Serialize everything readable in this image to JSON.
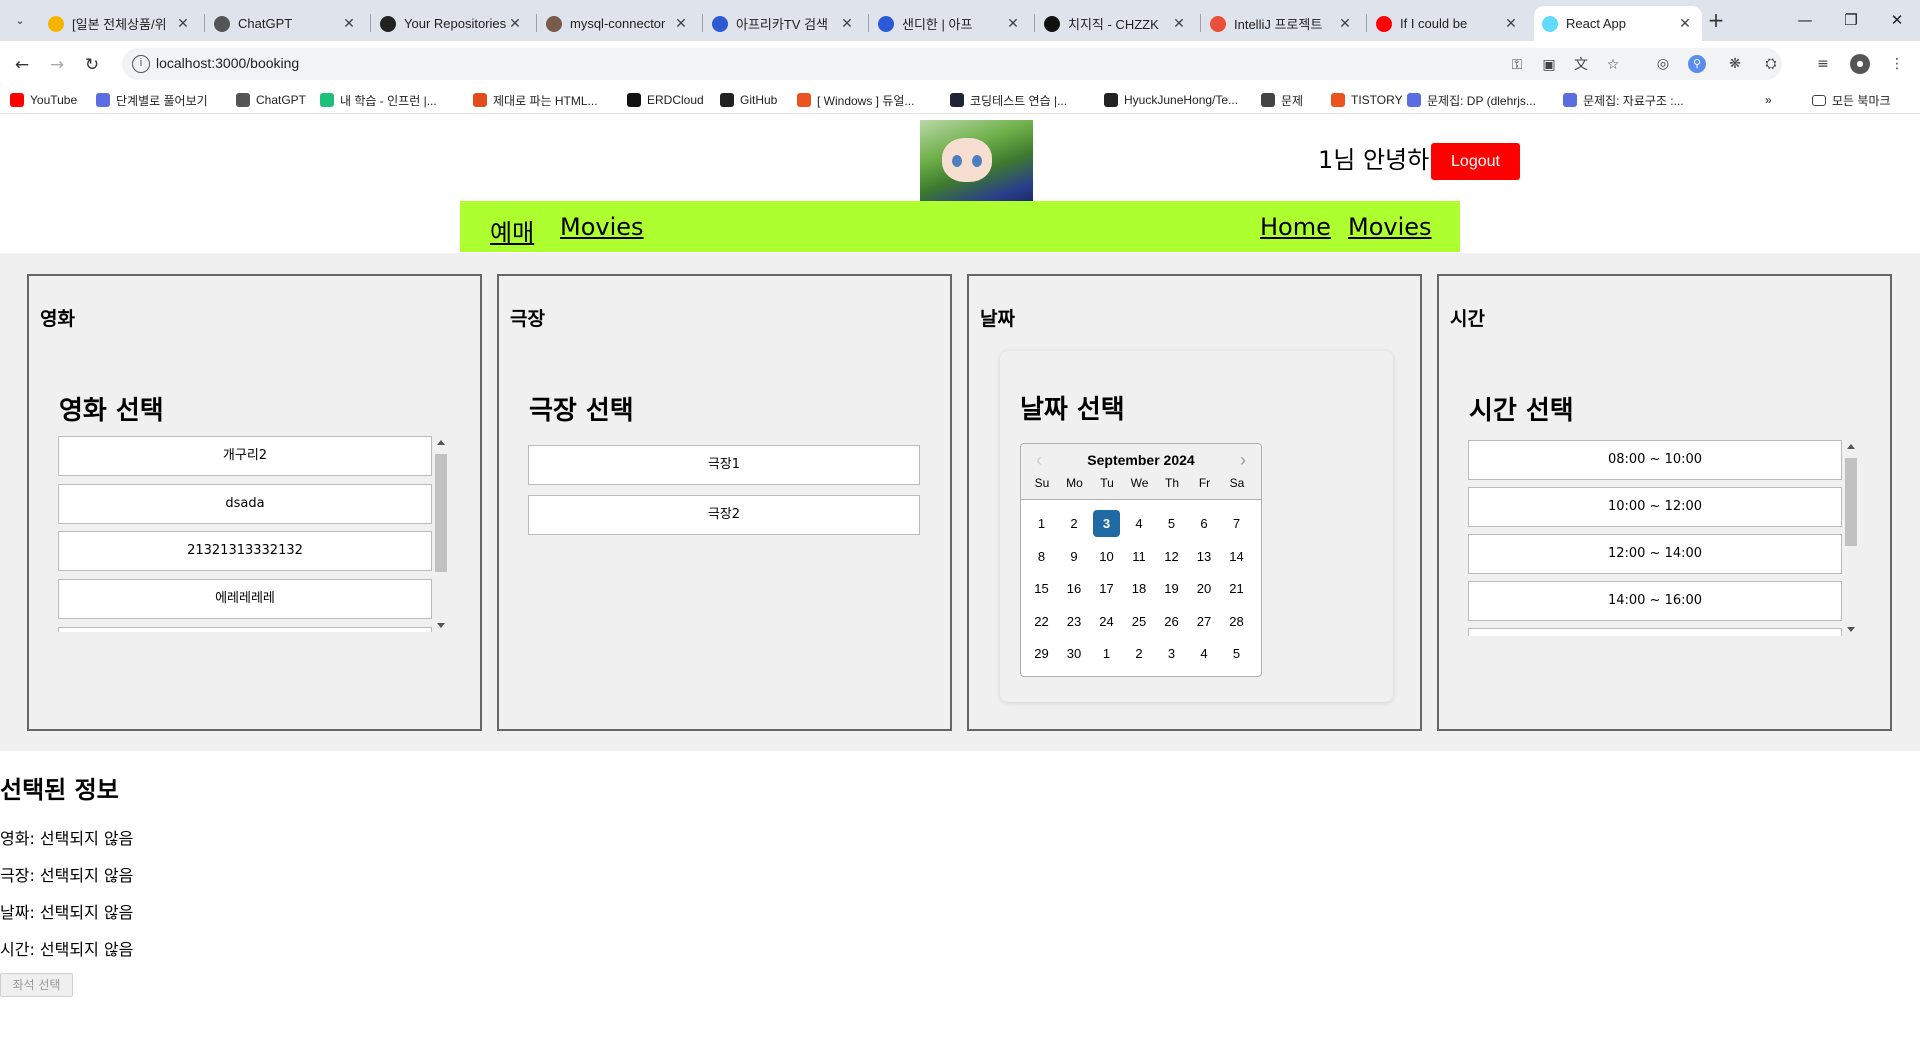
{
  "browser": {
    "tabs": [
      {
        "title": "[일본 전체상품/위",
        "icon": "store-icon",
        "color": "#f4b400"
      },
      {
        "title": "ChatGPT",
        "icon": "chatgpt-icon",
        "color": "#555555"
      },
      {
        "title": "Your Repositories",
        "icon": "github-icon",
        "color": "#222222"
      },
      {
        "title": "mysql-connector",
        "icon": "avatar-icon",
        "color": "#7a5a4a"
      },
      {
        "title": "아프리카TV 검색",
        "icon": "afreeca-icon",
        "color": "#2c5ad6"
      },
      {
        "title": "샌디한 | 아프",
        "icon": "afreeca-icon",
        "color": "#2c5ad6"
      },
      {
        "title": "치지직 - CHZZK",
        "icon": "chzzk-icon",
        "color": "#111111"
      },
      {
        "title": "IntelliJ 프로젝트",
        "icon": "inflearn-icon",
        "color": "#e8503a"
      },
      {
        "title": "If I could be",
        "icon": "youtube-icon",
        "color": "#ff0000"
      },
      {
        "title": "React App",
        "icon": "react-icon",
        "color": "#61dafb"
      }
    ],
    "url": "localhost:3000/booking",
    "bookmarks": [
      {
        "label": "YouTube",
        "icon": "youtube-icon",
        "color": "#ff0000"
      },
      {
        "label": "단계별로 풀어보기",
        "icon": "code-icon",
        "color": "#5b6ee1"
      },
      {
        "label": "ChatGPT",
        "icon": "chatgpt-icon",
        "color": "#555555"
      },
      {
        "label": "내 학습 - 인프런 |...",
        "icon": "inflearn-icon",
        "color": "#1dc078"
      },
      {
        "label": "제대로 파는 HTML...",
        "icon": "yalco-icon",
        "color": "#e24b1e"
      },
      {
        "label": "ERDCloud",
        "icon": "erd-icon",
        "color": "#111111"
      },
      {
        "label": "GitHub",
        "icon": "github-icon",
        "color": "#222222"
      },
      {
        "label": "[ Windows ] 듀얼...",
        "icon": "tistory-icon",
        "color": "#eb531f"
      },
      {
        "label": "코딩테스트 연습 |...",
        "icon": "programmers-icon",
        "color": "#1e2434"
      },
      {
        "label": "HyuckJuneHong/Te...",
        "icon": "github-icon",
        "color": "#222222"
      },
      {
        "label": "문제",
        "icon": "folder-icon",
        "color": "#444444"
      },
      {
        "label": "TISTORY",
        "icon": "tistory-icon",
        "color": "#eb531f"
      },
      {
        "label": "문제집: DP (dlehrjs...",
        "icon": "code-icon",
        "color": "#5b6ee1"
      },
      {
        "label": "문제집: 자료구조 :...",
        "icon": "code-icon",
        "color": "#5b6ee1"
      }
    ],
    "all_bookmarks": "모든 북마크"
  },
  "header": {
    "greeting": "1님 안녕하",
    "logout": "Logout"
  },
  "nav": {
    "left": [
      "예매",
      "Movies"
    ],
    "right": [
      "Home",
      "Movies"
    ]
  },
  "panels": {
    "movie": {
      "title": "영화",
      "heading": "영화 선택",
      "items": [
        "개구리2",
        "dsada",
        "21321313332132",
        "에레레레레"
      ]
    },
    "theater": {
      "title": "극장",
      "heading": "극장 선택",
      "items": [
        "극장1",
        "극장2"
      ]
    },
    "date": {
      "title": "날짜",
      "heading": "날짜 선택",
      "month": "September 2024",
      "weekdays": [
        "Su",
        "Mo",
        "Tu",
        "We",
        "Th",
        "Fr",
        "Sa"
      ],
      "weeks": [
        [
          "1",
          "2",
          "3",
          "4",
          "5",
          "6",
          "7"
        ],
        [
          "8",
          "9",
          "10",
          "11",
          "12",
          "13",
          "14"
        ],
        [
          "15",
          "16",
          "17",
          "18",
          "19",
          "20",
          "21"
        ],
        [
          "22",
          "23",
          "24",
          "25",
          "26",
          "27",
          "28"
        ],
        [
          "29",
          "30",
          "1",
          "2",
          "3",
          "4",
          "5"
        ]
      ],
      "selected": "3"
    },
    "time": {
      "title": "시간",
      "heading": "시간 선택",
      "items": [
        "08:00 ~ 10:00",
        "10:00 ~ 12:00",
        "12:00 ~ 14:00",
        "14:00 ~ 16:00"
      ]
    }
  },
  "selection": {
    "title": "선택된 정보",
    "movie": "영화: 선택되지 않음",
    "theater": "극장: 선택되지 않음",
    "date": "날짜: 선택되지 않음",
    "time": "시간: 선택되지 않음",
    "seat_button": "좌석 선택"
  },
  "colors": {
    "navbar": "#adff2f",
    "logout": "#ff0000",
    "calendar_selected": "#216ba5"
  }
}
